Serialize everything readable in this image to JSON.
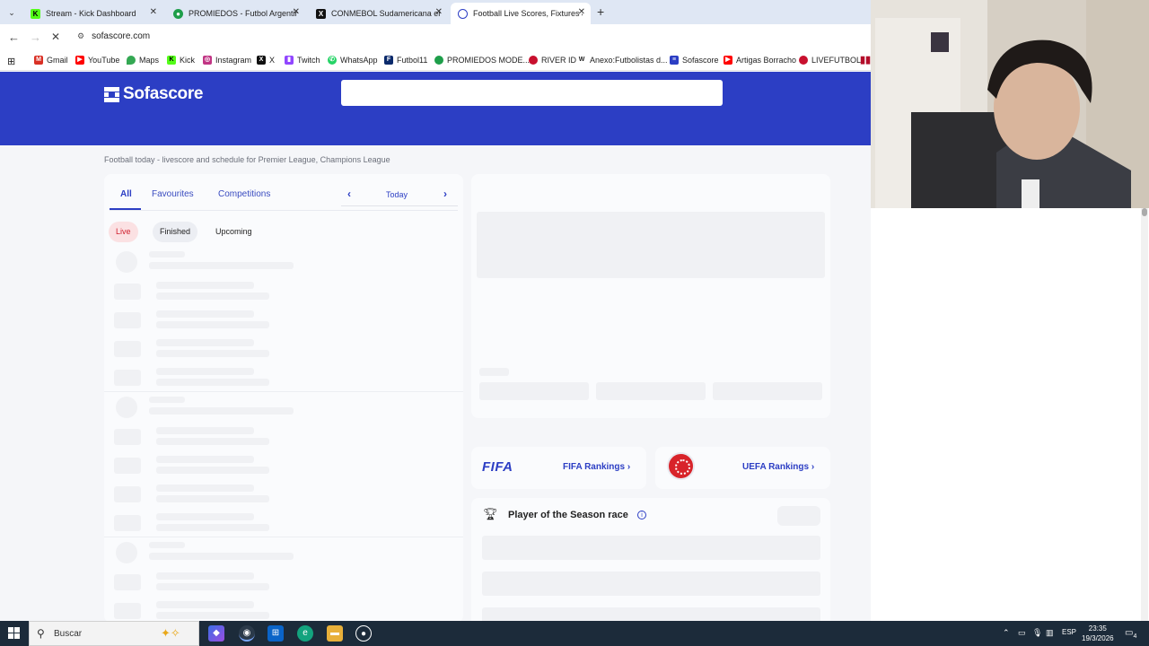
{
  "browser": {
    "tabs": [
      {
        "title": "Stream - Kick Dashboard",
        "icon": "kick-icon",
        "color": "#53fc18"
      },
      {
        "title": "PROMIEDOS - Futbol Argentino",
        "icon": "promiedos-icon",
        "color": "#1e9e4a"
      },
      {
        "title": "CONMEBOL Sudamericana en",
        "icon": "x-icon",
        "color": "#111111"
      },
      {
        "title": "Football Live Scores, Fixtures &",
        "icon": "sofascore-icon",
        "color": "#2c3ec4"
      }
    ],
    "url": "sofascore.com",
    "bookmarks": [
      {
        "label": "Gmail",
        "icon": "gmail-icon",
        "color": "#d93025"
      },
      {
        "label": "YouTube",
        "icon": "youtube-icon",
        "color": "#ff0000"
      },
      {
        "label": "Maps",
        "icon": "maps-icon",
        "color": "#34a853"
      },
      {
        "label": "Kick",
        "icon": "kick-icon",
        "color": "#53fc18"
      },
      {
        "label": "Instagram",
        "icon": "instagram-icon",
        "color": "#c13584"
      },
      {
        "label": "X",
        "icon": "x-icon",
        "color": "#111111"
      },
      {
        "label": "Twitch",
        "icon": "twitch-icon",
        "color": "#9146ff"
      },
      {
        "label": "WhatsApp",
        "icon": "whatsapp-icon",
        "color": "#25d366"
      },
      {
        "label": "Futbol11",
        "icon": "futbol11-icon",
        "color": "#0b2a6b"
      },
      {
        "label": "PROMIEDOS MODE...",
        "icon": "promiedos-icon",
        "color": "#1e9e4a"
      },
      {
        "label": "RIVER ID",
        "icon": "river-icon",
        "color": "#c8102e"
      },
      {
        "label": "Anexo:Futbolistas d...",
        "icon": "wikipedia-icon",
        "color": "#444444"
      },
      {
        "label": "Sofascore",
        "icon": "sofascore-icon",
        "color": "#2c3ec4"
      },
      {
        "label": "Artigas Borracho",
        "icon": "youtube-icon",
        "color": "#ff0000"
      },
      {
        "label": "LIVEFUTBOL",
        "icon": "livefutbol-icon",
        "color": "#c8102e"
      }
    ]
  },
  "sofascore": {
    "logo": "Sofascore",
    "brand_color": "#2c3ec4",
    "breadcrumb": "Football today - livescore and schedule for Premier League, Champions League",
    "tabs": [
      "All",
      "Favourites",
      "Competitions"
    ],
    "date_label": "Today",
    "filters": [
      "Live",
      "Finished",
      "Upcoming"
    ],
    "rankings": {
      "fifa_logo": "FIFA",
      "fifa": "FIFA Rankings",
      "uefa": "UEFA Rankings"
    },
    "pots_title": "Player of the Season race"
  },
  "taskbar": {
    "search_label": "Buscar",
    "language": "ESP",
    "time": "23:35",
    "date": "19/3/2026",
    "notification_count": "4"
  }
}
